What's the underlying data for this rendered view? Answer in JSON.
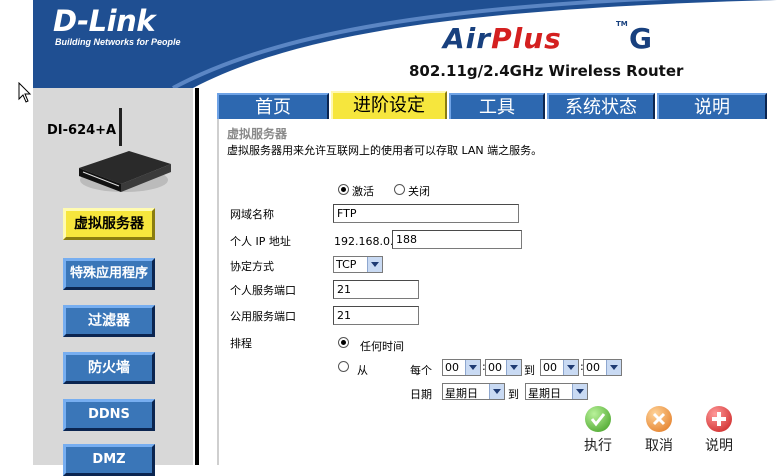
{
  "header": {
    "logo": "D-Link",
    "logo_tagline": "Building Networks for People",
    "product_air": "Air",
    "product_plus": "Plus",
    "product_g": "G",
    "product_tm": "TM",
    "subtitle": "802.11g/2.4GHz Wireless Router"
  },
  "sidebar": {
    "model": "DI-624+A",
    "items": [
      {
        "label": "虚拟服务器",
        "active": true
      },
      {
        "label": "特殊应用程序",
        "active": false
      },
      {
        "label": "过滤器",
        "active": false
      },
      {
        "label": "防火墙",
        "active": false
      },
      {
        "label": "DDNS",
        "active": false
      },
      {
        "label": "DMZ",
        "active": false
      }
    ]
  },
  "tabs": [
    {
      "label": "首页",
      "active": false
    },
    {
      "label": "进阶设定",
      "active": true
    },
    {
      "label": "工具",
      "active": false
    },
    {
      "label": "系统状态",
      "active": false
    },
    {
      "label": "说明",
      "active": false
    }
  ],
  "section": {
    "title": "虚拟服务器",
    "description": "虚拟服务器用来允许互联网上的使用者可以存取 LAN 端之服务。"
  },
  "form": {
    "enable_label": "激活",
    "disable_label": "关闭",
    "enabled": true,
    "name_label": "网域名称",
    "name_value": "FTP",
    "ip_label": "个人 IP 地址",
    "ip_prefix": "192.168.0.",
    "ip_value": "188",
    "protocol_label": "协定方式",
    "protocol_value": "TCP",
    "private_port_label": "个人服务端口",
    "private_port_value": "21",
    "public_port_label": "公用服务端口",
    "public_port_value": "21",
    "schedule_label": "排程",
    "schedule_always_label": "任何时间",
    "schedule_from_label": "从",
    "schedule_always": true,
    "every_label": "每个",
    "time_from_hour": "00",
    "time_from_min": "00",
    "to_label_1": "到",
    "time_to_hour": "00",
    "time_to_min": "00",
    "day_label": "日期",
    "day_from": "星期日",
    "to_label_2": "到",
    "day_to": "星期日",
    "colon": ":"
  },
  "actions": {
    "apply_label": "执行",
    "cancel_label": "取消",
    "help_label": "说明"
  },
  "colors": {
    "header_blue": "#1f4f92",
    "tab_blue": "#2d68b0",
    "active_yellow": "#f6e63d",
    "brand_red": "#d42020"
  }
}
